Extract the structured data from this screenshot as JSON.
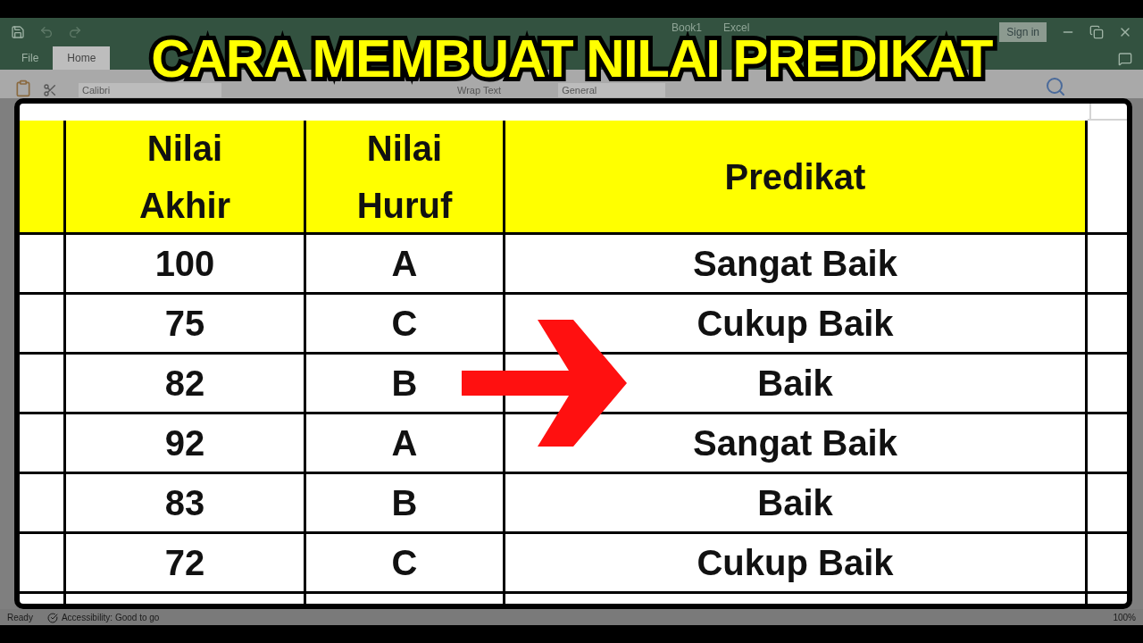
{
  "window": {
    "title_parts": [
      "Book1",
      "Excel"
    ],
    "sign_in": "Sign in"
  },
  "tabs": [
    {
      "label": "File",
      "selected": false
    },
    {
      "label": "Home",
      "selected": true
    }
  ],
  "ribbon": {
    "font": "Calibri",
    "wrap_text": "Wrap Text",
    "number_format": "General"
  },
  "overlay_title": "CARA MEMBUAT NILAI PREDIKAT",
  "table": {
    "columns": [
      "Nilai Akhir",
      "Nilai Huruf",
      "Predikat"
    ],
    "rows": [
      [
        "100",
        "A",
        "Sangat Baik"
      ],
      [
        "75",
        "C",
        "Cukup Baik"
      ],
      [
        "82",
        "B",
        "Baik"
      ],
      [
        "92",
        "A",
        "Sangat Baik"
      ],
      [
        "83",
        "B",
        "Baik"
      ],
      [
        "72",
        "C",
        "Cukup Baik"
      ]
    ]
  },
  "status_bar": {
    "status": "Ready",
    "accessibility": "Accessibility: Good to go",
    "zoom": "100%"
  }
}
